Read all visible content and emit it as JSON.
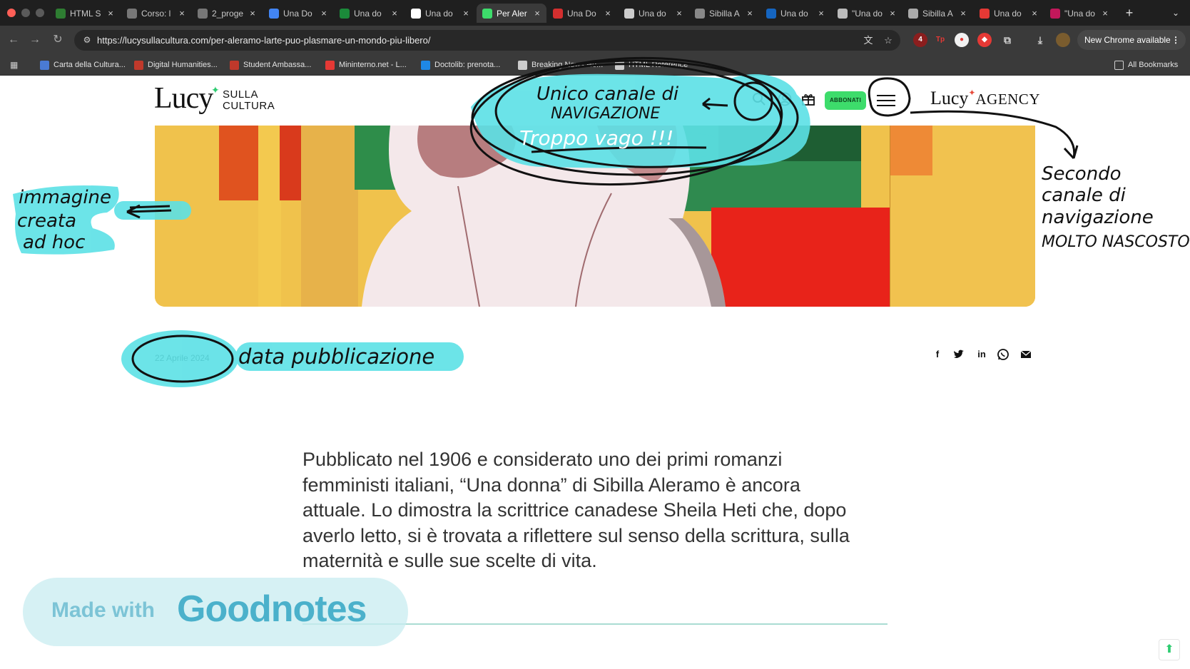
{
  "browser": {
    "tabs": [
      {
        "label": "HTML S",
        "icon": "w-green-icon",
        "color": "#2e7d32"
      },
      {
        "label": "Corso: l",
        "icon": "globe-icon",
        "color": "#777777"
      },
      {
        "label": "2_proge",
        "icon": "globe-icon",
        "color": "#777777"
      },
      {
        "label": "Una Do",
        "icon": "google-icon",
        "color": "#4285f4"
      },
      {
        "label": "Una do",
        "icon": "s-green-icon",
        "color": "#1b8a3a"
      },
      {
        "label": "Una do",
        "icon": "wikipedia-icon",
        "color": "#ffffff"
      },
      {
        "label": "Per Aler",
        "icon": "lucy-icon",
        "color": "#3ddc6b"
      },
      {
        "label": "Una Do",
        "icon": "pdf-icon",
        "color": "#d32f2f"
      },
      {
        "label": "Una do",
        "icon": "doc-icon",
        "color": "#cccccc"
      },
      {
        "label": "Sibilla A",
        "icon": "spiral-icon",
        "color": "#888888"
      },
      {
        "label": "Una do",
        "icon": "rai-icon",
        "color": "#1565c0"
      },
      {
        "label": "\"Una do",
        "icon": "doc-icon",
        "color": "#bbbbbb"
      },
      {
        "label": "Sibilla A",
        "icon": "book-icon",
        "color": "#aaaaaa"
      },
      {
        "label": "Una do",
        "icon": "red-square-icon",
        "color": "#e53935"
      },
      {
        "label": "\"Una do",
        "icon": "heart-book-icon",
        "color": "#c2185b"
      }
    ],
    "active_tab_index": 6,
    "new_tab": "+",
    "tab_menu": "⌄",
    "url": "https://lucysullacultura.com/per-aleramo-larte-puo-plasmare-un-mondo-piu-libero/",
    "extension_badge": "4",
    "update_label": "New Chrome available",
    "bookmarks": [
      {
        "label": "Carta della Cultura...",
        "color": "#4a7bd4"
      },
      {
        "label": "Digital Humanities...",
        "color": "#c0392b"
      },
      {
        "label": "Student Ambassa...",
        "color": "#c0392b"
      },
      {
        "label": "Mininterno.net - L...",
        "color": "#e53935"
      },
      {
        "label": "Doctolib: prenota...",
        "color": "#1e88e5"
      },
      {
        "label": "Breaking News He...",
        "color": "#cccccc"
      },
      {
        "label": "HTML Reference",
        "color": "#cccccc"
      }
    ],
    "all_bookmarks": "All Bookmarks"
  },
  "site": {
    "logo_main": "Lucy",
    "logo_sub_1": "SULLA",
    "logo_sub_2": "CULTURA",
    "subscribe_label": "ABBONATI",
    "agency_logo_1": "Lucy",
    "agency_logo_2": "AGENCY",
    "accent_color": "#3ddc6b"
  },
  "article": {
    "date": "22 Aprile 2024",
    "intro": "Pubblicato nel 1906 e considerato uno dei primi romanzi femministi italiani, “Una donna” di Sibilla Aleramo è ancora attuale. Lo dimostra la scrittrice canadese Sheila Heti che, dopo averlo letto, si è trovata a riflettere sul senso della scrittura, sulla maternità e sulle sue scelte di vita.",
    "share": [
      "facebook-icon",
      "twitter-icon",
      "linkedin-icon",
      "whatsapp-icon",
      "email-icon"
    ]
  },
  "annotations": {
    "nav_title_1": "Unico canale di",
    "nav_title_2": "NAVIGAZIONE",
    "nav_comment": "Troppo vago !!!",
    "image_note_1": "immagine",
    "image_note_2": "creata",
    "image_note_3": "ad hoc",
    "second_nav_1": "Secondo",
    "second_nav_2": "canale di",
    "second_nav_3": "navigazione",
    "second_nav_4": "MOLTO NASCOSTO",
    "date_note": "data pubblicazione",
    "highlight_color": "#5ce1e6"
  },
  "watermark": {
    "made_with": "Made with",
    "brand": "Goodnotes"
  }
}
